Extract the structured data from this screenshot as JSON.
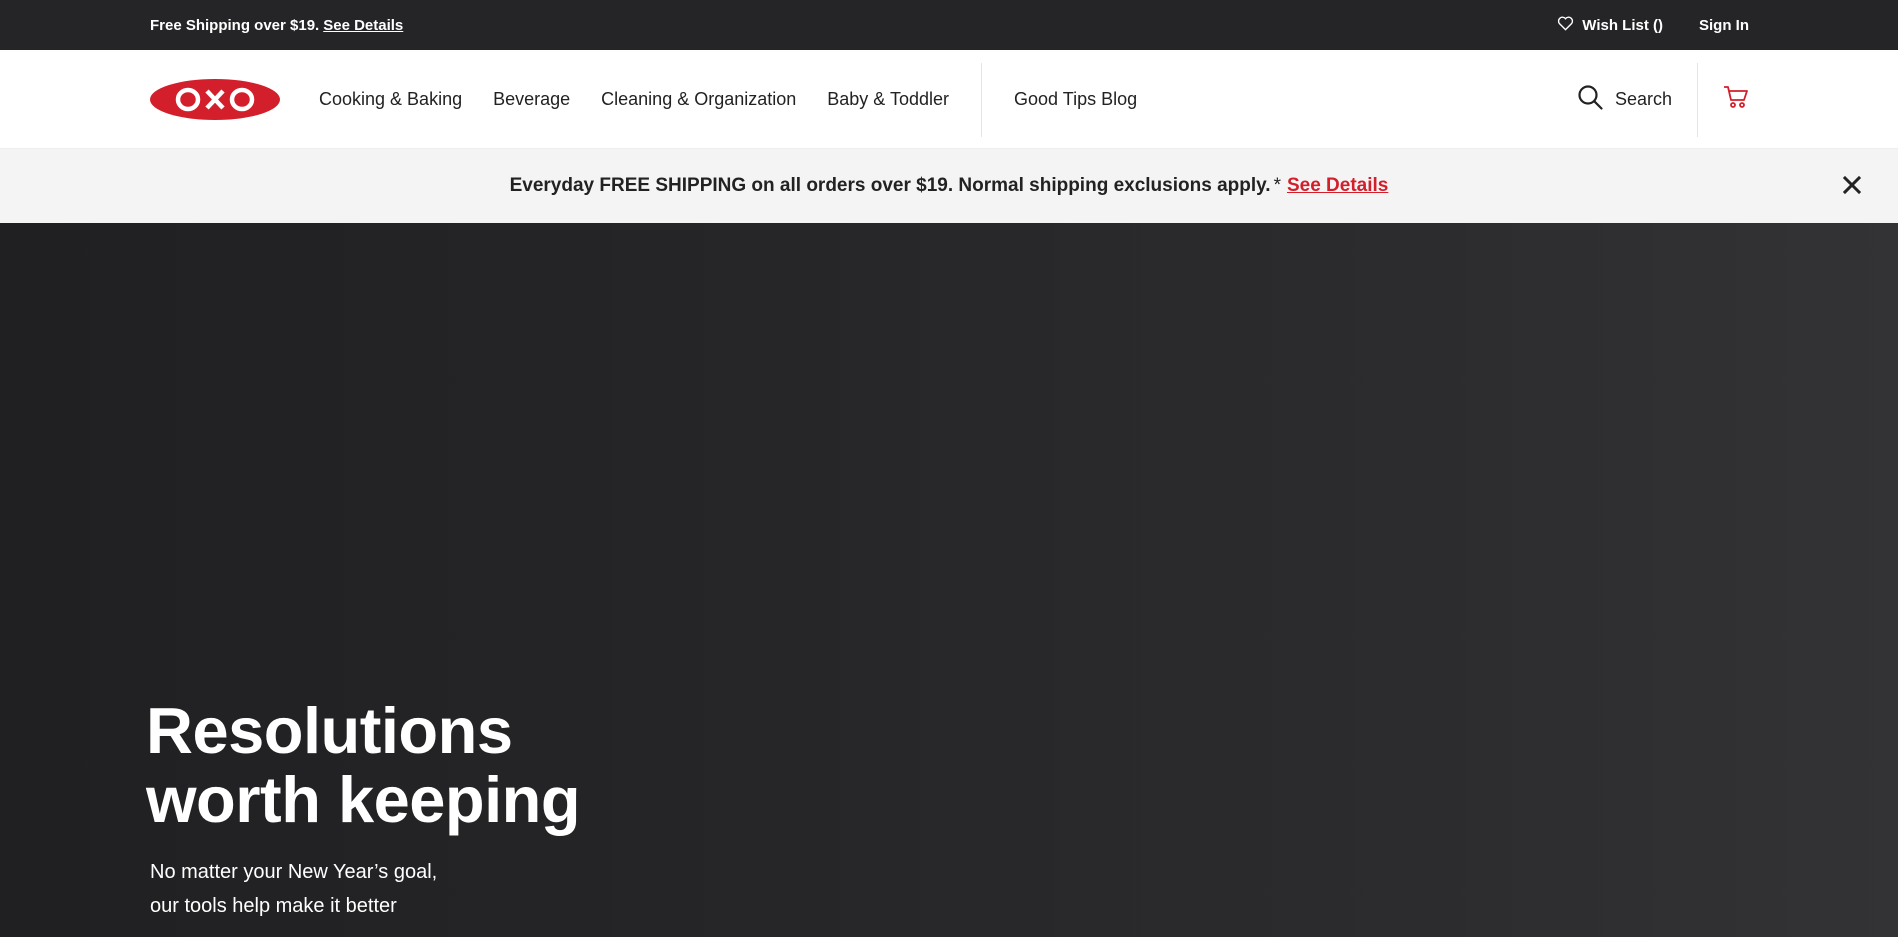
{
  "utility": {
    "shipping_text": "Free Shipping over $19.",
    "shipping_link": "See Details",
    "wishlist_label": "Wish List ()",
    "signin_label": "Sign In"
  },
  "logo": {
    "text": "OXO",
    "color": "#d21f2b"
  },
  "nav": {
    "items": [
      {
        "label": "Cooking & Baking"
      },
      {
        "label": "Beverage"
      },
      {
        "label": "Cleaning & Organization"
      },
      {
        "label": "Baby & Toddler"
      }
    ],
    "blog_label": "Good Tips Blog",
    "search_label": "Search"
  },
  "promo": {
    "text": "Everyday FREE SHIPPING on all orders over $19. Normal shipping exclusions apply.",
    "asterisk": "*",
    "link": "See Details",
    "link_color": "#d21f2b"
  },
  "hero": {
    "title_line1": "Resolutions",
    "title_line2": "worth keeping",
    "subtitle_line1": "No matter your New Year’s goal,",
    "subtitle_line2": "our tools help make it better"
  },
  "icons": {
    "wishlist": "heart-icon",
    "search": "search-icon",
    "cart": "cart-icon",
    "close": "close-icon"
  }
}
